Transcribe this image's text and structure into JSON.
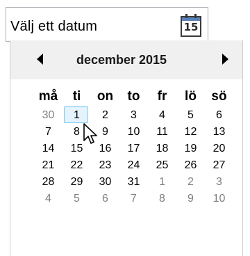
{
  "date_field": {
    "value": "Välj ett datum",
    "icon_day": "15"
  },
  "calendar": {
    "month_title": "december 2015",
    "weekdays": [
      "må",
      "ti",
      "on",
      "to",
      "fr",
      "lö",
      "sö"
    ],
    "weeks": [
      [
        "30",
        "1",
        "2",
        "3",
        "4",
        "5",
        "6"
      ],
      [
        "7",
        "8",
        "9",
        "10",
        "11",
        "12",
        "13"
      ],
      [
        "14",
        "15",
        "16",
        "17",
        "18",
        "19",
        "20"
      ],
      [
        "21",
        "22",
        "23",
        "24",
        "25",
        "26",
        "27"
      ],
      [
        "28",
        "29",
        "30",
        "31",
        "1",
        "2",
        "3"
      ],
      [
        "4",
        "5",
        "6",
        "7",
        "8",
        "9",
        "10"
      ]
    ],
    "other_month": [
      [
        true,
        false,
        false,
        false,
        false,
        false,
        false
      ],
      [
        false,
        false,
        false,
        false,
        false,
        false,
        false
      ],
      [
        false,
        false,
        false,
        false,
        false,
        false,
        false
      ],
      [
        false,
        false,
        false,
        false,
        false,
        false,
        false
      ],
      [
        false,
        false,
        false,
        false,
        true,
        true,
        true
      ],
      [
        true,
        true,
        true,
        true,
        true,
        true,
        true
      ]
    ],
    "highlighted": {
      "week": 0,
      "day": 1
    }
  },
  "colors": {
    "header_bg": "#f0f0f0",
    "highlight_border": "#7ec7ee",
    "highlight_bg": "#e4f3fc",
    "other_month_text": "#7f7f7f"
  }
}
